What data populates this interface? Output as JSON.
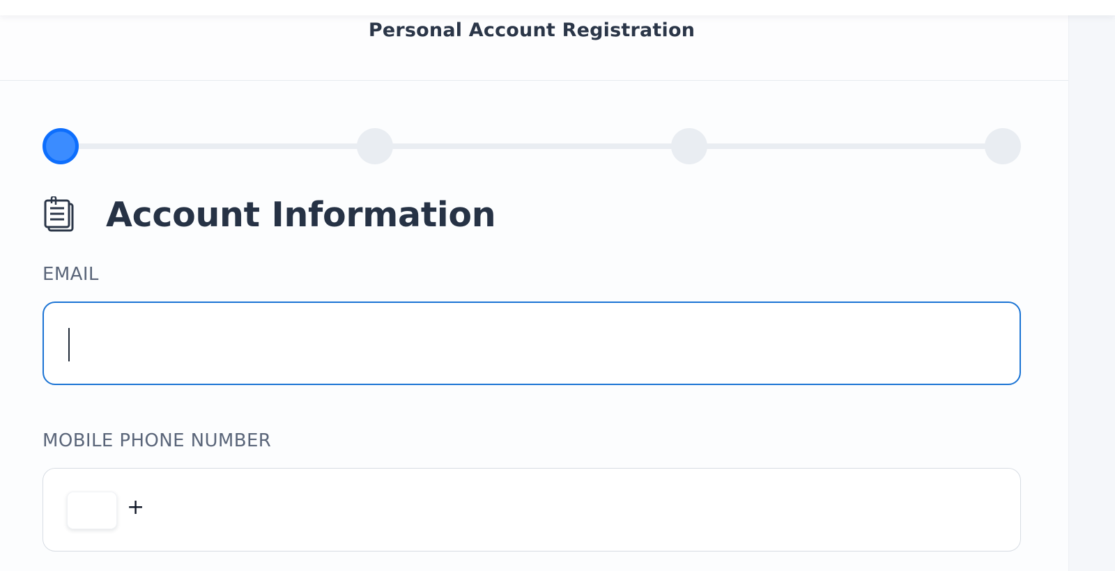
{
  "page": {
    "title": "Personal Account Registration"
  },
  "stepper": {
    "total_steps": 4,
    "current_step": 1,
    "active_color": "#0d6efd",
    "inactive_color": "#e9edf2"
  },
  "section": {
    "title": "Account Information",
    "icon": "document-icon"
  },
  "email": {
    "label": "EMAIL",
    "value": "",
    "placeholder": ""
  },
  "phone": {
    "label": "MOBILE PHONE NUMBER",
    "prefix": "+",
    "value": "",
    "country_flag": ""
  },
  "colors": {
    "accent": "#0d6efd",
    "focus_border": "#1a73d4",
    "text_primary": "#263245",
    "text_label": "#5a6579"
  }
}
